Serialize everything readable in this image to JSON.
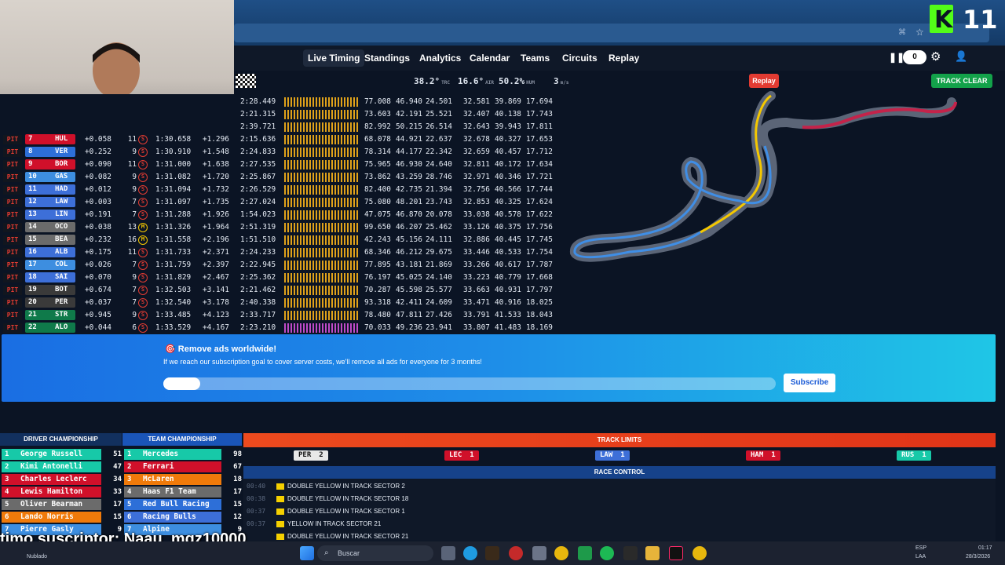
{
  "nav": {
    "links": [
      "Live Timing",
      "Standings",
      "Analytics",
      "Calendar",
      "Teams",
      "Circuits",
      "Replay"
    ],
    "counter": "0"
  },
  "weather": {
    "track": "38.2°",
    "track_unit": "TRC",
    "air": "16.6°",
    "air_unit": "AIR",
    "hum": "50.2%",
    "hum_unit": "HUM",
    "wind": "3",
    "wind_unit": "m/s"
  },
  "buttons": {
    "replay": "Replay",
    "track_clear": "TRACK CLEAR"
  },
  "timing_top": [
    {
      "last": "2:28.449",
      "s": [
        "77.008",
        "46.940",
        "24.501"
      ],
      "b": [
        "32.581",
        "39.869",
        "17.694"
      ]
    },
    {
      "last": "2:21.315",
      "s": [
        "73.603",
        "42.191",
        "25.521"
      ],
      "b": [
        "32.407",
        "40.138",
        "17.743"
      ]
    },
    {
      "last": "2:39.721",
      "s": [
        "82.992",
        "50.215",
        "26.514"
      ],
      "b": [
        "32.643",
        "39.943",
        "17.811"
      ]
    }
  ],
  "timing": [
    {
      "pit": "PIT",
      "num": "7",
      "team": "HUL",
      "color": "#d0102a",
      "gap": "+0.058",
      "laps": "11",
      "tyre": "S",
      "best": "1:30.658",
      "int": "+1.296",
      "last": "2:15.636",
      "s": [
        "68.078",
        "44.921",
        "22.637"
      ],
      "b": [
        "32.678",
        "40.327",
        "17.653"
      ]
    },
    {
      "pit": "PIT",
      "num": "8",
      "team": "VER",
      "color": "#2d6fd8",
      "gap": "+0.252",
      "laps": "9",
      "tyre": "S",
      "best": "1:30.910",
      "int": "+1.548",
      "last": "2:24.833",
      "s": [
        "78.314",
        "44.177",
        "22.342"
      ],
      "b": [
        "32.659",
        "40.457",
        "17.712"
      ]
    },
    {
      "pit": "PIT",
      "num": "9",
      "team": "BOR",
      "color": "#d0102a",
      "gap": "+0.090",
      "laps": "11",
      "tyre": "S",
      "best": "1:31.000",
      "int": "+1.638",
      "last": "2:27.535",
      "s": [
        "75.965",
        "46.930",
        "24.640"
      ],
      "b": [
        "32.811",
        "40.172",
        "17.634"
      ]
    },
    {
      "pit": "PIT",
      "num": "10",
      "team": "GAS",
      "color": "#3d8ee0",
      "gap": "+0.082",
      "laps": "9",
      "tyre": "S",
      "best": "1:31.082",
      "int": "+1.720",
      "last": "2:25.867",
      "s": [
        "73.862",
        "43.259",
        "28.746"
      ],
      "b": [
        "32.971",
        "40.346",
        "17.721"
      ]
    },
    {
      "pit": "PIT",
      "num": "11",
      "team": "HAD",
      "color": "#3d6fd8",
      "gap": "+0.012",
      "laps": "9",
      "tyre": "S",
      "best": "1:31.094",
      "int": "+1.732",
      "last": "2:26.529",
      "s": [
        "82.400",
        "42.735",
        "21.394"
      ],
      "b": [
        "32.756",
        "40.566",
        "17.744"
      ]
    },
    {
      "pit": "PIT",
      "num": "12",
      "team": "LAW",
      "color": "#3d6fd8",
      "gap": "+0.003",
      "laps": "7",
      "tyre": "S",
      "best": "1:31.097",
      "int": "+1.735",
      "last": "2:27.024",
      "s": [
        "75.080",
        "48.201",
        "23.743"
      ],
      "b": [
        "32.853",
        "40.325",
        "17.624"
      ]
    },
    {
      "pit": "PIT",
      "num": "13",
      "team": "LIN",
      "color": "#3d6fd8",
      "gap": "+0.191",
      "laps": "7",
      "tyre": "S",
      "best": "1:31.288",
      "int": "+1.926",
      "last": "1:54.023",
      "s": [
        "47.075",
        "46.870",
        "20.078"
      ],
      "b": [
        "33.038",
        "40.578",
        "17.622"
      ]
    },
    {
      "pit": "PIT",
      "num": "14",
      "team": "OCO",
      "color": "#6b6b6b",
      "gap": "+0.038",
      "laps": "13",
      "tyre": "M",
      "best": "1:31.326",
      "int": "+1.964",
      "last": "2:51.319",
      "s": [
        "99.650",
        "46.207",
        "25.462"
      ],
      "b": [
        "33.126",
        "40.375",
        "17.756"
      ]
    },
    {
      "pit": "PIT",
      "num": "15",
      "team": "BEA",
      "color": "#6b6b6b",
      "gap": "+0.232",
      "laps": "16",
      "tyre": "M",
      "best": "1:31.558",
      "int": "+2.196",
      "last": "1:51.510",
      "s": [
        "42.243",
        "45.156",
        "24.111"
      ],
      "b": [
        "32.886",
        "40.445",
        "17.745"
      ]
    },
    {
      "pit": "PIT",
      "num": "16",
      "team": "ALB",
      "color": "#3d6fd8",
      "gap": "+0.175",
      "laps": "11",
      "tyre": "S",
      "best": "1:31.733",
      "int": "+2.371",
      "last": "2:24.233",
      "s": [
        "68.346",
        "46.212",
        "29.675"
      ],
      "b": [
        "33.446",
        "40.533",
        "17.754"
      ]
    },
    {
      "pit": "PIT",
      "num": "17",
      "team": "COL",
      "color": "#3d8ee0",
      "gap": "+0.026",
      "laps": "7",
      "tyre": "S",
      "best": "1:31.759",
      "int": "+2.397",
      "last": "2:22.945",
      "s": [
        "77.895",
        "43.181",
        "21.869"
      ],
      "b": [
        "33.266",
        "40.617",
        "17.787"
      ]
    },
    {
      "pit": "PIT",
      "num": "18",
      "team": "SAI",
      "color": "#3d6fd8",
      "gap": "+0.070",
      "laps": "9",
      "tyre": "S",
      "best": "1:31.829",
      "int": "+2.467",
      "last": "2:25.362",
      "s": [
        "76.197",
        "45.025",
        "24.140"
      ],
      "b": [
        "33.223",
        "40.779",
        "17.668"
      ]
    },
    {
      "pit": "PIT",
      "num": "19",
      "team": "BOT",
      "color": "#3a3a3a",
      "gap": "+0.674",
      "laps": "7",
      "tyre": "S",
      "best": "1:32.503",
      "int": "+3.141",
      "last": "2:21.462",
      "s": [
        "70.287",
        "45.598",
        "25.577"
      ],
      "b": [
        "33.663",
        "40.931",
        "17.797"
      ]
    },
    {
      "pit": "PIT",
      "num": "20",
      "team": "PER",
      "color": "#3a3a3a",
      "gap": "+0.037",
      "laps": "7",
      "tyre": "S",
      "best": "1:32.540",
      "int": "+3.178",
      "last": "2:40.338",
      "s": [
        "93.318",
        "42.411",
        "24.609"
      ],
      "b": [
        "33.471",
        "40.916",
        "18.025"
      ]
    },
    {
      "pit": "PIT",
      "num": "21",
      "team": "STR",
      "color": "#0f7a4a",
      "gap": "+0.945",
      "laps": "9",
      "tyre": "S",
      "best": "1:33.485",
      "int": "+4.123",
      "last": "2:33.717",
      "s": [
        "78.480",
        "47.811",
        "27.426"
      ],
      "b": [
        "33.791",
        "41.533",
        "18.043"
      ]
    },
    {
      "pit": "PIT",
      "num": "22",
      "team": "ALO",
      "color": "#0f7a4a",
      "gap": "+0.044",
      "laps": "6",
      "tyre": "S",
      "best": "1:33.529",
      "int": "+4.167",
      "last": "2:23.210",
      "s": [
        "70.033",
        "49.236",
        "23.941"
      ],
      "b": [
        "33.807",
        "41.483",
        "18.169"
      ]
    }
  ],
  "banner": {
    "title": "Remove ads worldwide!",
    "desc": "If we reach our subscription goal to cover server costs, we'll remove all ads for everyone for 3 months!",
    "progress": 0.06,
    "subscribe": "Subscribe"
  },
  "driver_championship": {
    "title": "DRIVER CHAMPIONSHIP",
    "rows": [
      {
        "pos": "1",
        "name": "George Russell",
        "pts": "51",
        "color": "#17c9a8"
      },
      {
        "pos": "2",
        "name": "Kimi Antonelli",
        "pts": "47",
        "color": "#17c9a8"
      },
      {
        "pos": "3",
        "name": "Charles Leclerc",
        "pts": "34",
        "color": "#d0102a"
      },
      {
        "pos": "4",
        "name": "Lewis Hamilton",
        "pts": "33",
        "color": "#d0102a"
      },
      {
        "pos": "5",
        "name": "Oliver Bearman",
        "pts": "17",
        "color": "#6b6b6b"
      },
      {
        "pos": "6",
        "name": "Lando Norris",
        "pts": "15",
        "color": "#f07a0a"
      },
      {
        "pos": "7",
        "name": "Pierre Gasly",
        "pts": "9",
        "color": "#3d8ee0"
      }
    ]
  },
  "team_championship": {
    "title": "TEAM CHAMPIONSHIP",
    "rows": [
      {
        "pos": "1",
        "name": "Mercedes",
        "pts": "98",
        "color": "#17c9a8"
      },
      {
        "pos": "2",
        "name": "Ferrari",
        "pts": "67",
        "color": "#d0102a"
      },
      {
        "pos": "3",
        "name": "McLaren",
        "pts": "18",
        "color": "#f07a0a"
      },
      {
        "pos": "4",
        "name": "Haas F1 Team",
        "pts": "17",
        "color": "#6b6b6b"
      },
      {
        "pos": "5",
        "name": "Red Bull Racing",
        "pts": "15",
        "color": "#2d6fd8"
      },
      {
        "pos": "6",
        "name": "Racing Bulls",
        "pts": "12",
        "color": "#3d6fd8"
      },
      {
        "pos": "7",
        "name": "Alpine",
        "pts": "9",
        "color": "#3d8ee0"
      }
    ]
  },
  "track_limits": {
    "title": "TRACK LIMITS",
    "items": [
      {
        "code": "PER",
        "count": "2",
        "color": "#e8e8e8",
        "text": "#111"
      },
      {
        "code": "LEC",
        "count": "1",
        "color": "#d0102a",
        "text": "#fff"
      },
      {
        "code": "LAW",
        "count": "1",
        "color": "#3d6fd8",
        "text": "#fff"
      },
      {
        "code": "HAM",
        "count": "1",
        "color": "#d0102a",
        "text": "#fff"
      },
      {
        "code": "RUS",
        "count": "1",
        "color": "#17c9a8",
        "text": "#fff"
      }
    ]
  },
  "race_control": {
    "title": "RACE CONTROL",
    "messages": [
      {
        "time": "00:40",
        "msg": "DOUBLE YELLOW IN TRACK SECTOR 2"
      },
      {
        "time": "00:38",
        "msg": "DOUBLE YELLOW IN TRACK SECTOR 18"
      },
      {
        "time": "00:37",
        "msg": "DOUBLE YELLOW IN TRACK SECTOR 1"
      },
      {
        "time": "00:37",
        "msg": "YELLOW IN TRACK SECTOR 21"
      },
      {
        "time": "",
        "msg": "DOUBLE YELLOW IN TRACK SECTOR 21"
      }
    ]
  },
  "overlay_text": "timo suscriptor: Naau_mqz10000",
  "taskbar": {
    "search": "Buscar",
    "weather_status": "Nublado",
    "lang": "ESP",
    "lang2": "LAA",
    "time": "01:17",
    "date": "28/3/2026"
  },
  "logo": {
    "text": "11"
  }
}
